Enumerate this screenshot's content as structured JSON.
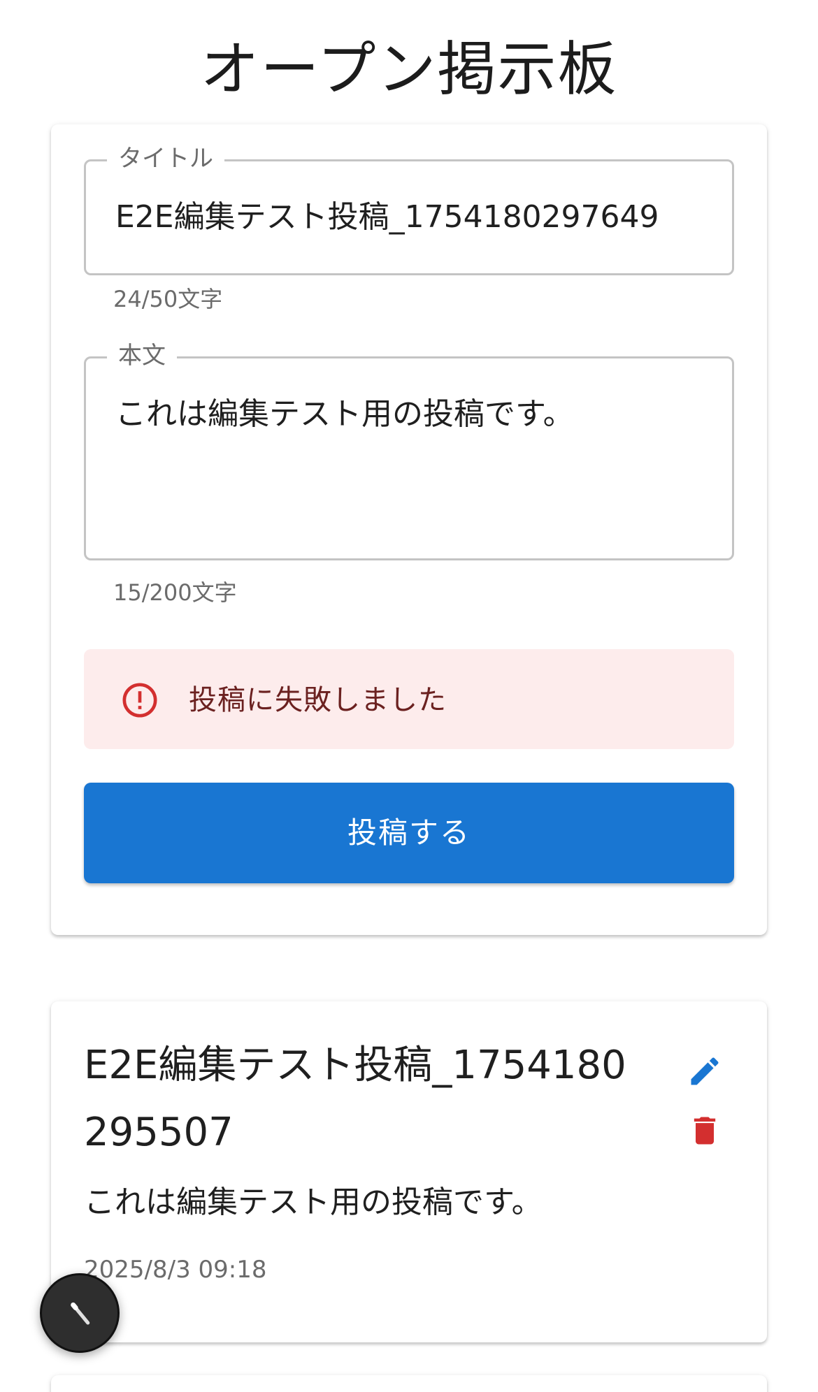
{
  "app": {
    "title": "オープン掲示板"
  },
  "form": {
    "title_label": "タイトル",
    "title_value": "E2E編集テスト投稿_1754180297649",
    "title_counter": "24/50文字",
    "body_label": "本文",
    "body_value": "これは編集テスト用の投稿です。",
    "body_counter": "15/200文字",
    "error_message": "投稿に失敗しました",
    "submit_label": "投稿する"
  },
  "posts": [
    {
      "title": "E2E編集テスト投稿_1754180295507",
      "body": "これは編集テスト用の投稿です。",
      "date": "2025/8/3 09:18"
    }
  ],
  "icons": {
    "alert": "error-outline-icon",
    "edit": "pencil-icon",
    "delete": "trash-icon",
    "fab": "wand-icon"
  },
  "colors": {
    "primary": "#1976d2",
    "error": "#d32f2f",
    "error_bg": "#fdecec",
    "error_text": "#6b2120"
  }
}
